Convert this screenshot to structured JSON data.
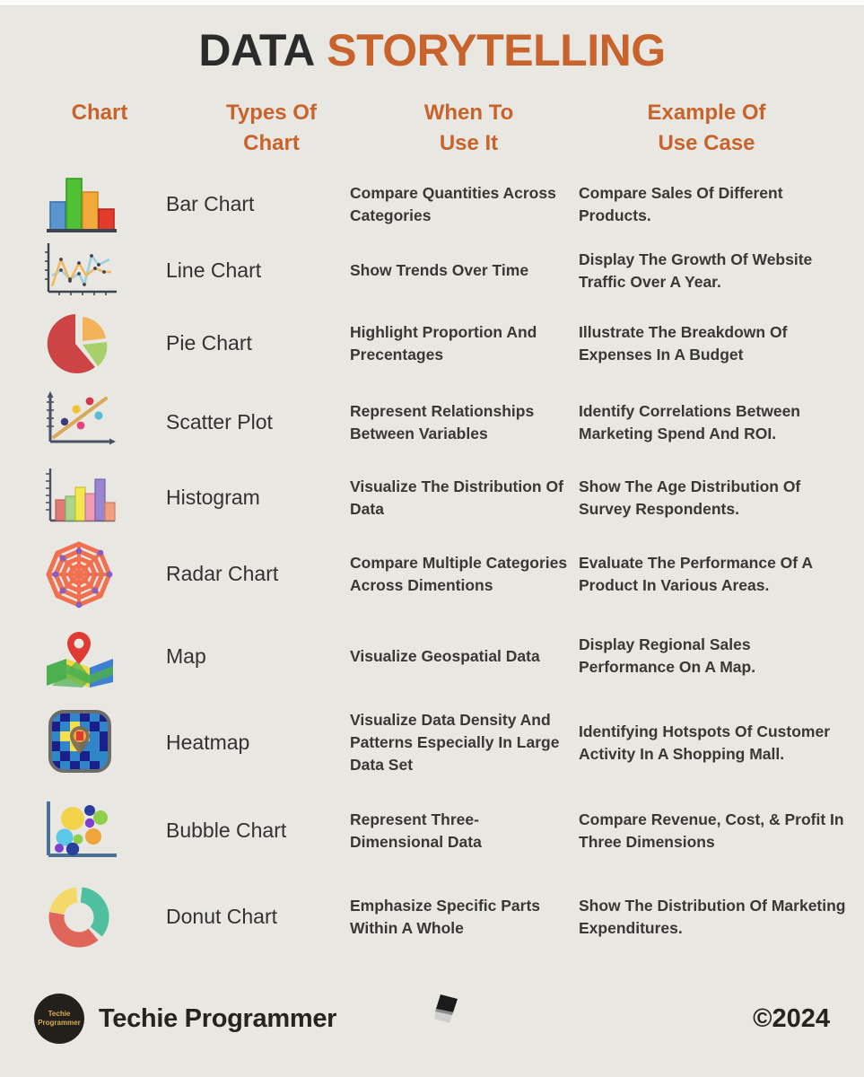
{
  "title": {
    "word1": "DATA",
    "word2": "STORYTELLING",
    "accent_color": "#c8632b"
  },
  "columns": {
    "chart": "Chart",
    "types_line1": "Types Of",
    "types_line2": "Chart",
    "when_line1": "When To",
    "when_line2": "Use It",
    "example_line1": "Example Of",
    "example_line2": "Use Case"
  },
  "rows": [
    {
      "icon": "bar-chart-icon",
      "type": "Bar Chart",
      "when": "Compare Quantities Across Categories",
      "example": "Compare Sales Of Different Products."
    },
    {
      "icon": "line-chart-icon",
      "type": "Line Chart",
      "when": "Show Trends Over Time",
      "example": "Display The Growth Of Website Traffic Over A Year."
    },
    {
      "icon": "pie-chart-icon",
      "type": "Pie Chart",
      "when": "Highlight Proportion And Precentages",
      "example": "Illustrate The Breakdown Of Expenses In A Budget"
    },
    {
      "icon": "scatter-plot-icon",
      "type": "Scatter Plot",
      "when": "Represent Relationships Between Variables",
      "example": "Identify Correlations Between Marketing Spend And ROI."
    },
    {
      "icon": "histogram-icon",
      "type": "Histogram",
      "when": "Visualize The Distribution Of Data",
      "example": "Show The Age Distribution Of Survey Respondents."
    },
    {
      "icon": "radar-chart-icon",
      "type": "Radar Chart",
      "when": "Compare Multiple Categories Across Dimentions",
      "example": "Evaluate The Performance Of A Product In Various Areas."
    },
    {
      "icon": "map-icon",
      "type": "Map",
      "when": "Visualize Geospatial Data",
      "example": "Display Regional Sales Performance On A Map."
    },
    {
      "icon": "heatmap-icon",
      "type": "Heatmap",
      "when": "Visualize Data Density And Patterns Especially In Large Data Set",
      "example": "Identifying Hotspots Of Customer Activity In A Shopping Mall."
    },
    {
      "icon": "bubble-chart-icon",
      "type": "Bubble Chart",
      "when": "Represent Three-Dimensional Data",
      "example": "Compare Revenue, Cost, & Profit In Three Dimensions"
    },
    {
      "icon": "donut-chart-icon",
      "type": "Donut Chart",
      "when": "Emphasize Specific Parts Within A Whole",
      "example": "Show The Distribution Of Marketing Expenditures."
    }
  ],
  "footer": {
    "logo_line1": "Techie",
    "logo_line2": "Programmer",
    "brand": "Techie Programmer",
    "copyright": "©2024"
  },
  "chart_data": {
    "type": "table",
    "title": "DATA STORYTELLING",
    "columns": [
      "Chart",
      "Types Of Chart",
      "When To Use It",
      "Example Of Use Case"
    ],
    "icon_previews": {
      "bar-chart-icon": {
        "type": "bar",
        "values": [
          55,
          100,
          78,
          42
        ],
        "colors": [
          "#5b95d0",
          "#4fc134",
          "#f4a93c",
          "#e33a2e"
        ]
      },
      "line-chart-icon": {
        "type": "line",
        "series": [
          {
            "name": "blue",
            "values": [
              28,
              44,
              30,
              58,
              24,
              78,
              62,
              86
            ],
            "color": "#9ecfe0"
          },
          {
            "name": "orange",
            "values": [
              8,
              62,
              30,
              70,
              34,
              56,
              46,
              44
            ],
            "color": "#f0b860"
          }
        ]
      },
      "pie-chart-icon": {
        "type": "pie",
        "values": [
          55,
          15,
          30
        ],
        "colors": [
          "#cc4444",
          "#f2b35a",
          "#a8cf6a"
        ],
        "exploded": true
      },
      "scatter-plot-icon": {
        "type": "scatter",
        "point_colors": [
          "#3b3b7a",
          "#f2c230",
          "#e8427c",
          "#d8354f",
          "#5bbcd8"
        ],
        "trendline_color": "#d9a959"
      },
      "histogram-icon": {
        "type": "bar",
        "values": [
          48,
          56,
          76,
          62,
          96,
          42
        ],
        "colors": [
          "#e07a74",
          "#a9d68c",
          "#f2e84f",
          "#f09ab4",
          "#9a85cf",
          "#f0a080"
        ]
      },
      "radar-chart-icon": {
        "type": "radar",
        "spokes": 8,
        "rings": 4,
        "color": "#f0704f",
        "vertex_color": "#8560c0"
      },
      "map-icon": {
        "type": "map",
        "colors": [
          "#4caf50",
          "#3f7fd4",
          "#f5d93a",
          "#8ed6f0"
        ],
        "pin_color": "#e03a34"
      },
      "heatmap-icon": {
        "type": "heatmap",
        "low_color": "#1b1f8a",
        "mid_color": "#2f86c8",
        "high_color": "#f4e04d",
        "hot_color": "#e03a34"
      },
      "bubble-chart-icon": {
        "type": "scatter",
        "bubble_colors": [
          "#f2d24a",
          "#5bc8e8",
          "#2a3f9e",
          "#8ed04a",
          "#f0a63c",
          "#7d3fd0"
        ],
        "axis_color": "#4a7296"
      },
      "donut-chart-icon": {
        "type": "pie",
        "values": [
          35,
          40,
          25
        ],
        "colors": [
          "#4fbfa0",
          "#e0665c",
          "#f4d96a"
        ],
        "hole": 0.5
      }
    }
  }
}
